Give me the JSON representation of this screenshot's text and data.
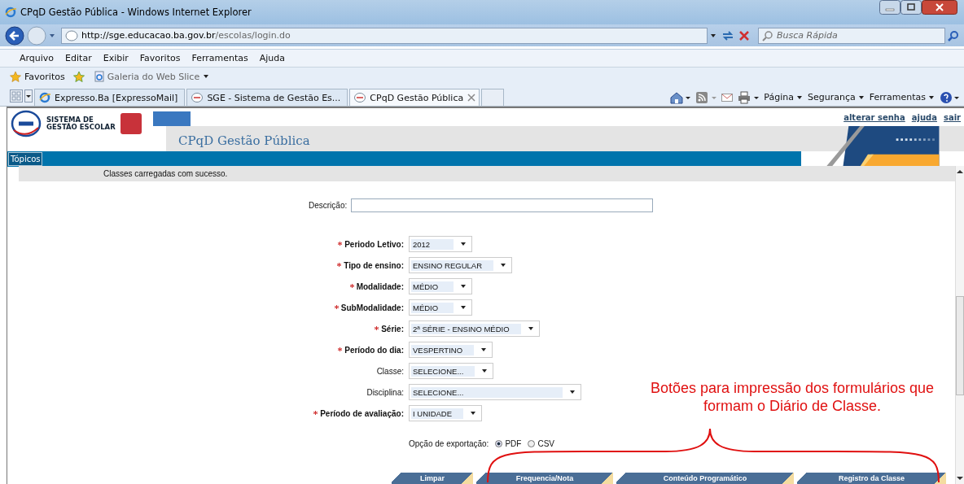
{
  "window": {
    "title": "CPqD Gestão Pública - Windows Internet Explorer"
  },
  "address_bar": {
    "url_host": "http://sge.educacao.ba.gov.br",
    "url_path": "/escolas/login.do",
    "search_placeholder": "Busca Rápida"
  },
  "menu": [
    "Arquivo",
    "Editar",
    "Exibir",
    "Favoritos",
    "Ferramentas",
    "Ajuda"
  ],
  "favorites_bar": {
    "favorites": "Favoritos",
    "web_slice": "Galeria do Web Slice"
  },
  "tabs": [
    {
      "label": "Expresso.Ba [ExpressoMail]",
      "selected": false
    },
    {
      "label": "SGE - Sistema de Gestão Es...",
      "selected": false
    },
    {
      "label": "CPqD Gestão Pública",
      "selected": true
    }
  ],
  "command_bar": [
    "Página",
    "Segurança",
    "Ferramentas"
  ],
  "site_header": {
    "logo_line1": "SISTEMA DE",
    "logo_line2": "GESTÃO ESCOLAR",
    "title": "CPqD Gestão Pública",
    "links": [
      "alterar senha",
      "ajuda",
      "sair"
    ],
    "nav_button": "Tópicos"
  },
  "message": "Classes carregadas com sucesso.",
  "description": {
    "label": "Descrição:"
  },
  "fields": [
    {
      "label": "Periodo Letivo:",
      "value": "2012",
      "required": true
    },
    {
      "label": "Tipo de ensino:",
      "value": "ENSINO REGULAR",
      "required": true
    },
    {
      "label": "Modalidade:",
      "value": "MÉDIO",
      "required": true
    },
    {
      "label": "SubModalidade:",
      "value": "MÉDIO",
      "required": true
    },
    {
      "label": "Série:",
      "value": "2ª SÉRIE - ENSINO MÉDIO",
      "required": true
    },
    {
      "label": "Período do dia:",
      "value": "VESPERTINO",
      "required": true
    },
    {
      "label": "Classe:",
      "value": "SELECIONE...",
      "required": false
    },
    {
      "label": "Disciplina:",
      "value": "SELECIONE...",
      "required": false
    },
    {
      "label": "Período de avaliação:",
      "value": "I UNIDADE",
      "required": true
    }
  ],
  "export": {
    "label": "Opção de exportação:",
    "options": [
      {
        "label": "PDF",
        "selected": true
      },
      {
        "label": "CSV",
        "selected": false
      }
    ]
  },
  "buttons": [
    "Limpar",
    "Frequencia/Nota",
    "Conteúdo Programático",
    "Registro da Classe"
  ],
  "annotation": "Botões para impressão dos formulários que formam o Diário de Classe."
}
